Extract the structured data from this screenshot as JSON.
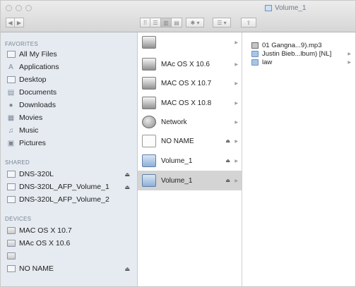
{
  "window": {
    "title": "Volume_1"
  },
  "toolbar": {
    "back": "◀",
    "forward": "▶",
    "view_icons": "⠿",
    "view_list": "☰",
    "view_columns": "▥",
    "view_cover": "▤",
    "action": "✱ ▾",
    "arrange": "☰ ▾",
    "share": "⇪"
  },
  "sidebar": {
    "favorites_header": "FAVORITES",
    "favorites": [
      {
        "label": "All My Files",
        "icon": "all-files-icon"
      },
      {
        "label": "Applications",
        "icon": "applications-icon"
      },
      {
        "label": "Desktop",
        "icon": "desktop-icon"
      },
      {
        "label": "Documents",
        "icon": "documents-icon"
      },
      {
        "label": "Downloads",
        "icon": "downloads-icon"
      },
      {
        "label": "Movies",
        "icon": "movies-icon"
      },
      {
        "label": "Music",
        "icon": "music-icon"
      },
      {
        "label": "Pictures",
        "icon": "pictures-icon"
      }
    ],
    "shared_header": "SHARED",
    "shared": [
      {
        "label": "DNS-320L",
        "eject": "⏏"
      },
      {
        "label": "DNS-320L_AFP_Volume_1",
        "eject": "⏏"
      },
      {
        "label": "DNS-320L_AFP_Volume_2",
        "eject": ""
      }
    ],
    "devices_header": "DEVICES",
    "devices": [
      {
        "label": "MAC OS X 10.7",
        "eject": ""
      },
      {
        "label": "MAc OS X 10.6",
        "eject": ""
      },
      {
        "label": "",
        "eject": ""
      },
      {
        "label": "NO NAME",
        "eject": "⏏"
      }
    ]
  },
  "column2": {
    "items": [
      {
        "label": "",
        "icon": "drive-icon",
        "eject": "",
        "arrow": "▶",
        "selected": false
      },
      {
        "label": "MAc OS X 10.6",
        "icon": "drive-icon",
        "eject": "",
        "arrow": "▶",
        "selected": false
      },
      {
        "label": "MAC OS X 10.7",
        "icon": "drive-icon",
        "eject": "",
        "arrow": "▶",
        "selected": false
      },
      {
        "label": "MAC OS X 10.8",
        "icon": "drive-icon",
        "eject": "",
        "arrow": "▶",
        "selected": false
      },
      {
        "label": "Network",
        "icon": "network-icon",
        "eject": "",
        "arrow": "▶",
        "selected": false
      },
      {
        "label": "NO NAME",
        "icon": "external-drive-icon",
        "eject": "⏏",
        "arrow": "▶",
        "selected": false
      },
      {
        "label": "Volume_1",
        "icon": "volume-icon",
        "eject": "⏏",
        "arrow": "▶",
        "selected": false
      },
      {
        "label": "Volume_1",
        "icon": "volume-icon",
        "eject": "⏏",
        "arrow": "▶",
        "selected": true
      }
    ]
  },
  "column3": {
    "items": [
      {
        "label": "01 Gangna...9).mp3",
        "icon": "mp3-file-icon",
        "arrow": ""
      },
      {
        "label": "Justin Bieb...lbum) [NL]",
        "icon": "folder-icon",
        "arrow": "▶"
      },
      {
        "label": "law",
        "icon": "folder-icon",
        "arrow": "▶"
      }
    ]
  }
}
